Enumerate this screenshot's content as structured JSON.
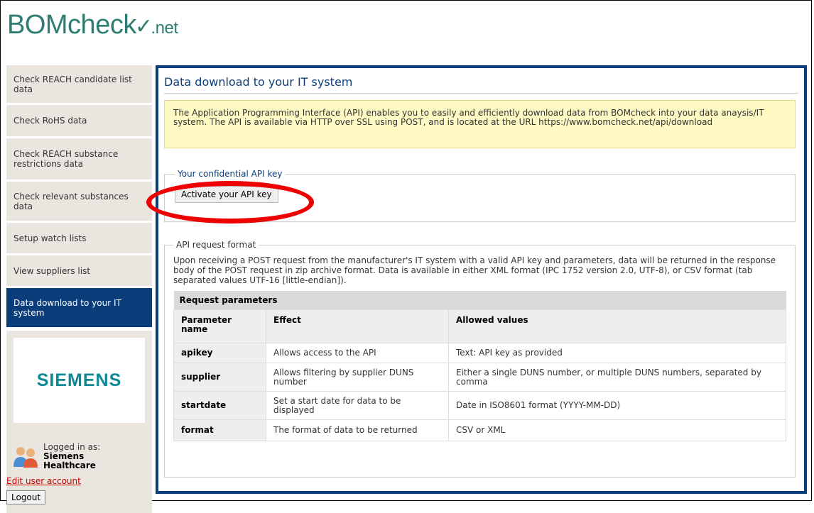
{
  "logo": {
    "brand": "BOMcheck",
    "tick": "✓",
    "suffix": ".net"
  },
  "sidebar": {
    "items": [
      {
        "label": "Check REACH candidate list data",
        "active": false
      },
      {
        "label": "Check RoHS data",
        "active": false
      },
      {
        "label": "Check REACH substance restrictions data",
        "active": false
      },
      {
        "label": "Check relevant substances data",
        "active": false
      },
      {
        "label": "Setup watch lists",
        "active": false
      },
      {
        "label": "View suppliers list",
        "active": false
      },
      {
        "label": "Data download to your IT system",
        "active": true
      }
    ],
    "company_logo": "SIEMENS",
    "logged_in_label": "Logged in as:",
    "user_name_line1": "Siemens",
    "user_name_line2": "Healthcare",
    "edit_account": "Edit user account",
    "logout": "Logout"
  },
  "main": {
    "title": "Data download to your IT system",
    "info": "The Application Programming Interface (API) enables you to easily and efficiently download data from BOMcheck into your data anaysis/IT system. The API is available via HTTP over SSL using POST, and is located at the URL https://www.bomcheck.net/api/download",
    "api_key_legend": "Your confidential API key",
    "activate_button": "Activate your API key",
    "format_legend": "API request format",
    "format_text": "Upon receiving a POST request from the manufacturer's IT system with a valid API key and parameters, data will be returned in the response body of the POST request in zip archive format. Data is available in either XML format (IPC 1752 version 2.0, UTF-8), or CSV format (tab separated values UTF-16 [little-endian]).",
    "table": {
      "caption": "Request parameters",
      "headers": [
        "Parameter name",
        "Effect",
        "Allowed values"
      ],
      "rows": [
        [
          "apikey",
          "Allows access to the API",
          "Text: API key as provided"
        ],
        [
          "supplier",
          "Allows filtering by supplier DUNS number",
          "Either a single DUNS number, or multiple DUNS numbers, separated by comma"
        ],
        [
          "startdate",
          "Set a start date for data to be displayed",
          "Date in ISO8601 format (YYYY-MM-DD)"
        ],
        [
          "format",
          "The format of data to be returned",
          "CSV or XML"
        ]
      ]
    }
  },
  "colors": {
    "navy": "#0b3d7a",
    "logo_teal": "#2e7d73",
    "siemens_teal": "#0e8a96",
    "highlight_red": "#e00000"
  }
}
